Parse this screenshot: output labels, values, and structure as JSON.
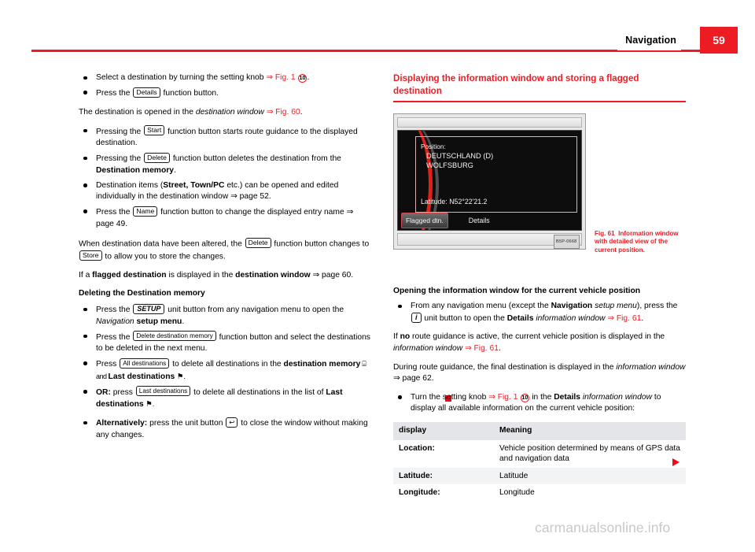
{
  "header": {
    "title": "Navigation",
    "page_number": "59",
    "accent_color": "#ed1c24"
  },
  "left_column": {
    "bullets_1": [
      {
        "pre": "Select a destination by turning the setting knob ",
        "ref": "⇒ Fig. 1 ",
        "callout": "10",
        "post": "."
      },
      {
        "pre": "Press the ",
        "key": "Details",
        "post": " function button."
      }
    ],
    "para_destination_opened": {
      "pre": "The destination is opened in the ",
      "italic": "destination window",
      "ref": " ⇒ Fig. 60",
      "post": "."
    },
    "bullets_2": [
      {
        "pre": "Pressing the ",
        "key": "Start",
        "post": " function button starts route guidance to the displayed destination."
      },
      {
        "pre": "Pressing the ",
        "key": "Delete",
        "mid": " function button deletes the destination from the ",
        "bold": "Destination memory",
        "post": "."
      },
      {
        "pre": "Destination items (",
        "bold1": "Street, Town/PC",
        "mid": " etc.) can be opened and edited individually in the destination window ⇒ page 52.",
        "post": ""
      },
      {
        "pre": "Press the ",
        "key": "Name",
        "post": " function button to change the displayed entry name ⇒ page 49."
      }
    ],
    "para_altered": {
      "pre": "When destination data have been altered, the ",
      "key1": "Delete",
      "mid": " function button changes to ",
      "key2": "Store",
      "post": " to allow you to store the changes."
    },
    "para_flagged": {
      "pre": "If a ",
      "bold1": "flagged destination",
      "mid": " is displayed in the ",
      "bold2": "destination window",
      "post": " ⇒ page 60."
    },
    "subheading_delete": "Deleting the Destination memory",
    "bullets_3": [
      {
        "pre": "Press the ",
        "key": "SETUP",
        "mid": " unit button from any navigation menu to open the ",
        "italic": "Navigation",
        "bold": " setup menu",
        "post": "."
      },
      {
        "pre": "Press the ",
        "key": "Delete destination memory",
        "post": " function button and select the destinations to be deleted in the next menu."
      },
      {
        "pre": "Press ",
        "key": "All destinations",
        "mid": " to delete all destinations in the ",
        "bold1": "destination memory",
        "mid2": " ⌸ and ",
        "bold2": "Last destinations",
        "post": " ⚑."
      },
      {
        "boldlead": "OR:",
        "pre": " press ",
        "key": "Last destinations",
        "mid": " to delete all destinations in the list of ",
        "bold1": "Last destinations",
        "post": " ⚑."
      },
      {
        "boldlead": "Alternatively:",
        "pre": " press the unit button ",
        "key": "↩",
        "post": " to close the window without making any changes."
      }
    ]
  },
  "right_column": {
    "section_heading": "Displaying the information window and storing a flagged destination",
    "figure": {
      "screen": {
        "position_label": "Position:",
        "country": "DEUTSCHLAND (D)",
        "city": "WOLFSBURG",
        "latitude": "Latitude: N52°22'21.2",
        "button_selected": "Flagged dtn.",
        "button_plain": "Details"
      },
      "code": "B5P-0668",
      "caption_number": "Fig. 61",
      "caption_text": "Information window with detailed view of the current position."
    },
    "subheading_opening": "Opening the information window for the current vehicle position",
    "bullet_from_any": {
      "pre": "From any navigation menu (except the ",
      "bold": "Navigation",
      "italic": " setup menu",
      "mid": "), press the ",
      "key": "i",
      "mid2": " unit button to open the ",
      "bold2": "Details",
      "italic2": " information window",
      "ref": " ⇒ Fig. 61",
      "post": "."
    },
    "para_no_guidance": {
      "pre": "If ",
      "bold": "no",
      "mid": " route guidance is active, the current vehicle position is displayed in the ",
      "italic": "information window",
      "ref": " ⇒ Fig. 61",
      "post": "."
    },
    "para_during_guidance": {
      "pre": "During route guidance, the final destination is displayed in the ",
      "italic": "information window",
      "post": " ⇒ page 62."
    },
    "bullet_turn_knob": {
      "pre": "Turn the setting knob ",
      "ref": "⇒ Fig. 1 ",
      "callout": "10",
      "mid": " in the ",
      "bold": "Details",
      "italic": " information window",
      "post": " to display all available information on the current vehicle position:"
    },
    "table": {
      "headers": [
        "display",
        "Meaning"
      ],
      "rows": [
        {
          "display": "Location:",
          "meaning": "Vehicle position determined by means of GPS data and navigation data"
        },
        {
          "display": "Latitude:",
          "meaning": "Latitude"
        },
        {
          "display": "Longitude:",
          "meaning": "Longitude"
        }
      ]
    }
  },
  "watermark": "carmanualsonline.info"
}
